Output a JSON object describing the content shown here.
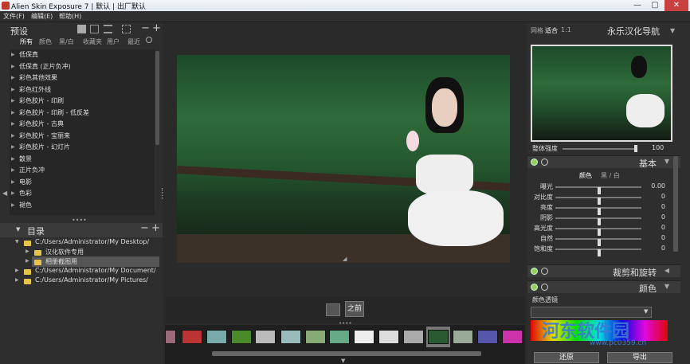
{
  "window": {
    "title": "Alien Skin Exposure 7 | 默认 | 出厂默认",
    "min": "—",
    "max": "▢",
    "close": "✕"
  },
  "menu": [
    "文件(F)",
    "编辑(E)",
    "帮助(H)"
  ],
  "left": {
    "presets_title": "预设",
    "tabs": [
      "所有",
      "颜色",
      "黑/白",
      "收藏夹",
      "用户",
      "最近"
    ],
    "presets": [
      "低保真",
      "低保真 (正片负冲)",
      "彩色其他效果",
      "彩色红外线",
      "彩色胶片 - 印刷",
      "彩色胶片 - 印刷 - 低反差",
      "彩色胶片 - 古典",
      "彩色胶片 - 宝丽来",
      "彩色胶片 - 幻灯片",
      "散景",
      "正片负冲",
      "电影",
      "色彩",
      "褪色"
    ],
    "dir_title": "目录",
    "dirs": [
      {
        "label": "C:/Users/Administrator/My Desktop/",
        "level": 0,
        "open": true
      },
      {
        "label": "汉化软件专用",
        "level": 1,
        "open": false
      },
      {
        "label": "相册截图用",
        "level": 1,
        "open": false,
        "selected": true
      },
      {
        "label": "C:/Users/Administrator/My Document/",
        "level": 0,
        "open": false
      },
      {
        "label": "C:/Users/Administrator/My Pictures/",
        "level": 0,
        "open": false
      }
    ]
  },
  "center": {
    "before_label": "之前",
    "thumb_selected": 11
  },
  "right": {
    "nav_tabs": [
      "网格",
      "适合",
      "1:1"
    ],
    "nav_title": "永乐汉化导航",
    "overall_label": "整体强度",
    "overall_value": "100",
    "overall_level": 1.0,
    "basic_title": "基本",
    "color_tabs": [
      "颜色",
      "黑 / 白"
    ],
    "sliders": [
      {
        "label": "曝光",
        "value": "0.00"
      },
      {
        "label": "对比度",
        "value": "0"
      },
      {
        "label": "亮度",
        "value": "0"
      },
      {
        "label": "阴影",
        "value": "0"
      },
      {
        "label": "高光度",
        "value": "0"
      },
      {
        "label": "自然",
        "value": "0"
      },
      {
        "label": "饱和度",
        "value": "0"
      }
    ],
    "crop_title": "裁剪和旋转",
    "color_title": "颜色",
    "lens_label": "颜色透镜",
    "restore_label": "还原",
    "export_label": "导出",
    "watermark1": "河东软件园",
    "watermark2": "www.pc0359.cn"
  },
  "colors": {
    "accent": "#3a7bd5",
    "folder": "#e5c44a"
  }
}
